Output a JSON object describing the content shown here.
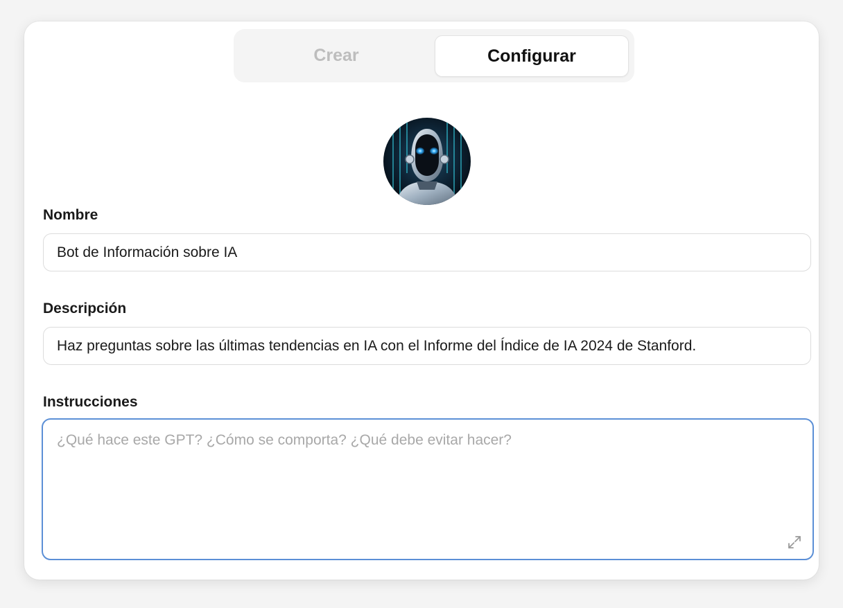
{
  "tabs": [
    {
      "label": "Crear",
      "active": false
    },
    {
      "label": "Configurar",
      "active": true
    }
  ],
  "avatar": {
    "icon": "robot-avatar"
  },
  "name_field": {
    "label": "Nombre",
    "value": "Bot de Información sobre IA"
  },
  "description_field": {
    "label": "Descripción",
    "value": "Haz preguntas sobre las últimas tendencias en IA con el Informe del Índice de IA 2024 de Stanford."
  },
  "instructions_field": {
    "label": "Instrucciones",
    "value": "",
    "placeholder": "¿Qué hace este GPT? ¿Cómo se comporta? ¿Qué debe evitar hacer?",
    "expand_icon": "expand-icon"
  },
  "colors": {
    "focus_border": "#5b8fd6",
    "inactive_tab_text": "#bdbdbd",
    "placeholder_text": "#a8a8a8"
  }
}
